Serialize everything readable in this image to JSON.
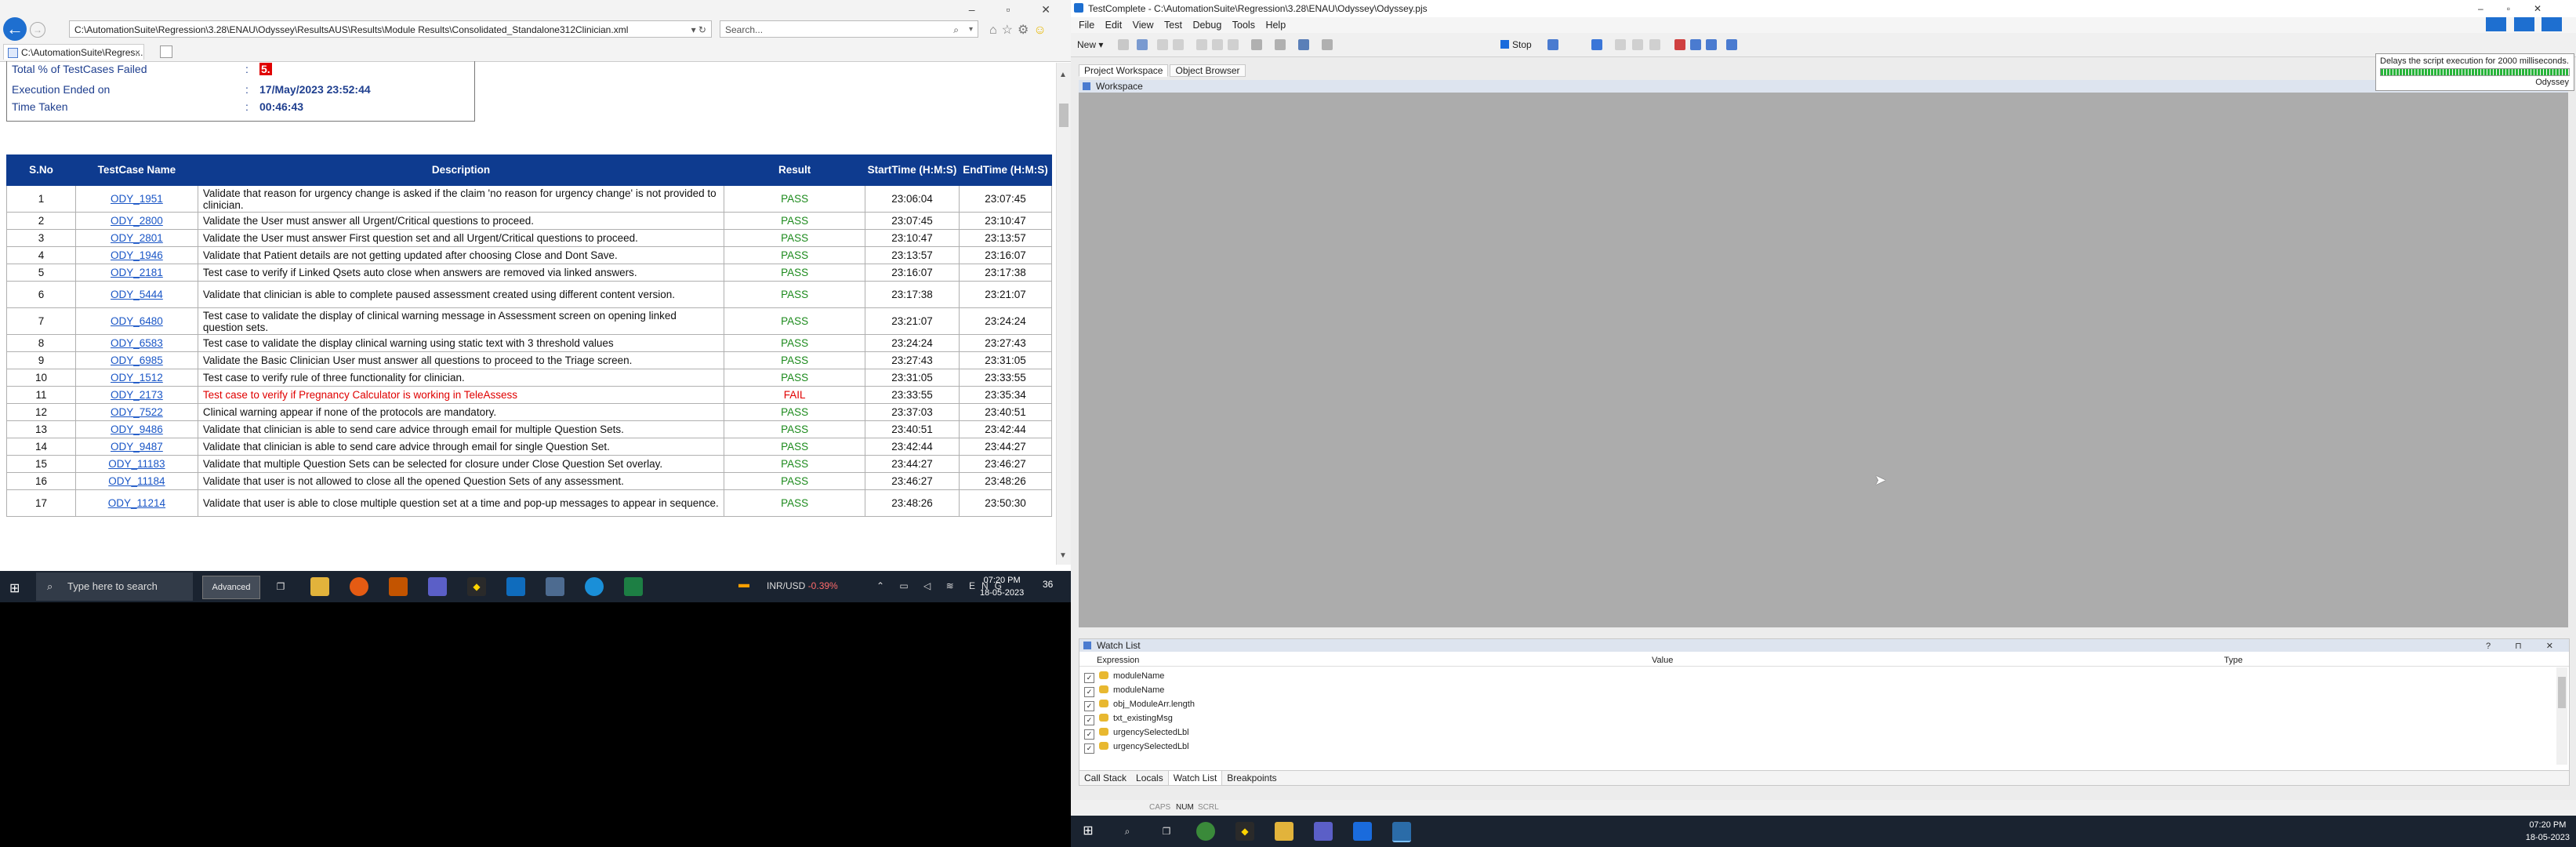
{
  "browser": {
    "address": "C:\\AutomationSuite\\Regression\\3.28\\ENAU\\Odyssey\\ResultsAUS\\Results\\Module Results\\Consolidated_Standalone312Clinician.xml",
    "address_controls": "▾ ↻",
    "search_placeholder": "Search...",
    "tab_title": "C:\\AutomationSuite\\Regres...",
    "back_glyph": "←",
    "forward_glyph": "→",
    "close_glyph": "×",
    "window_controls": "–  ▫  ✕",
    "toolbar_icons": [
      "home-icon",
      "star-icon",
      "gear-icon",
      "smiley-icon"
    ]
  },
  "summary": {
    "rows": [
      {
        "label": "Total % of TestCases Failed",
        "colon": ":",
        "value": "5."
      },
      {
        "label": "Execution Ended on",
        "colon": ":",
        "value": "17/May/2023 23:52:44"
      },
      {
        "label": "Time Taken",
        "colon": ":",
        "value": "00:46:43"
      }
    ]
  },
  "results_table": {
    "headers": [
      "S.No",
      "TestCase Name",
      "Description",
      "Result",
      "StartTime (H:M:S)",
      "EndTime (H:M:S)"
    ],
    "rows": [
      {
        "sno": "1",
        "name": "ODY_1951",
        "desc": "Validate that reason for urgency change is asked if the claim 'no reason for urgency change' is not provided to clinician.",
        "result": "PASS",
        "start": "23:06:04",
        "end": "23:07:45"
      },
      {
        "sno": "2",
        "name": "ODY_2800",
        "desc": "Validate the User must answer all Urgent/Critical questions to proceed.",
        "result": "PASS",
        "start": "23:07:45",
        "end": "23:10:47"
      },
      {
        "sno": "3",
        "name": "ODY_2801",
        "desc": "Validate the User must answer First question set and all Urgent/Critical questions to proceed.",
        "result": "PASS",
        "start": "23:10:47",
        "end": "23:13:57"
      },
      {
        "sno": "4",
        "name": "ODY_1946",
        "desc": "Validate that Patient details are not getting updated after choosing Close and Dont Save.",
        "result": "PASS",
        "start": "23:13:57",
        "end": "23:16:07"
      },
      {
        "sno": "5",
        "name": "ODY_2181",
        "desc": "Test case to verify if Linked Qsets auto close when answers are removed via linked answers.",
        "result": "PASS",
        "start": "23:16:07",
        "end": "23:17:38"
      },
      {
        "sno": "6",
        "name": "ODY_5444",
        "desc": "Validate that clinician is able to complete paused assessment created using different content version.",
        "result": "PASS",
        "start": "23:17:38",
        "end": "23:21:07"
      },
      {
        "sno": "7",
        "name": "ODY_6480",
        "desc": "Test case to validate the display of clinical warning message in Assessment screen on opening linked question sets.",
        "result": "PASS",
        "start": "23:21:07",
        "end": "23:24:24"
      },
      {
        "sno": "8",
        "name": "ODY_6583",
        "desc": "Test case to validate the display clinical warning using static text with 3 threshold values",
        "result": "PASS",
        "start": "23:24:24",
        "end": "23:27:43"
      },
      {
        "sno": "9",
        "name": "ODY_6985",
        "desc": "Validate the Basic Clinician User must answer all questions to proceed to the Triage screen.",
        "result": "PASS",
        "start": "23:27:43",
        "end": "23:31:05"
      },
      {
        "sno": "10",
        "name": "ODY_1512",
        "desc": "Test case to verify rule of three functionality for clinician.",
        "result": "PASS",
        "start": "23:31:05",
        "end": "23:33:55"
      },
      {
        "sno": "11",
        "name": "ODY_2173",
        "desc": "Test case to verify if Pregnancy Calculator is working in TeleAssess",
        "result": "FAIL",
        "start": "23:33:55",
        "end": "23:35:34"
      },
      {
        "sno": "12",
        "name": "ODY_7522",
        "desc": "Clinical warning appear if none of the protocols are mandatory.",
        "result": "PASS",
        "start": "23:37:03",
        "end": "23:40:51"
      },
      {
        "sno": "13",
        "name": "ODY_9486",
        "desc": "Validate that clinician is able to send care advice through email for multiple Question Sets.",
        "result": "PASS",
        "start": "23:40:51",
        "end": "23:42:44"
      },
      {
        "sno": "14",
        "name": "ODY_9487",
        "desc": "Validate that clinician is able to send care advice through email for single Question Set.",
        "result": "PASS",
        "start": "23:42:44",
        "end": "23:44:27"
      },
      {
        "sno": "15",
        "name": "ODY_11183",
        "desc": "Validate that multiple Question Sets can be selected for closure under Close Question Set overlay.",
        "result": "PASS",
        "start": "23:44:27",
        "end": "23:46:27"
      },
      {
        "sno": "16",
        "name": "ODY_11184",
        "desc": "Validate that user is not allowed to close all the opened Question Sets of any assessment.",
        "result": "PASS",
        "start": "23:46:27",
        "end": "23:48:26"
      },
      {
        "sno": "17",
        "name": "ODY_11214",
        "desc": "Validate that user is able to close multiple question set at a time and pop-up messages to appear in sequence.",
        "result": "PASS",
        "start": "23:48:26",
        "end": "23:50:30"
      }
    ]
  },
  "taskbar_left": {
    "search_placeholder": "Type here to search",
    "advanced_label": "Advanced",
    "currency": "INR/USD",
    "currency_change": "-0.39%",
    "lang": "ENG",
    "time": "07:20 PM",
    "date": "18-05-2023",
    "notif_count": "36"
  },
  "testcomplete": {
    "title": "TestComplete - C:\\AutomationSuite\\Regression\\3.28\\ENAU\\Odyssey\\Odyssey.pjs",
    "menu": [
      "File",
      "Edit",
      "View",
      "Test",
      "Debug",
      "Tools",
      "Help"
    ],
    "new_label": "New",
    "stop_label": "Stop",
    "tabs": [
      "Project Workspace",
      "Object Browser"
    ],
    "workspace_label": "Workspace",
    "tooltip_text": "Delays the script execution for 2000 milliseconds.",
    "tooltip_project": "Odyssey",
    "watch_title": "Watch List",
    "watch_columns": [
      "Expression",
      "Value",
      "Type"
    ],
    "watch_rows": [
      "moduleName",
      "moduleName",
      "obj_ModuleArr.length",
      "txt_existingMsg",
      "urgencySelectedLbl",
      "urgencySelectedLbl"
    ],
    "bottom_tabs": [
      "Call Stack",
      "Locals",
      "Watch List",
      "Breakpoints"
    ],
    "status": [
      "CAPS",
      "NUM",
      "SCRL"
    ]
  },
  "taskbar_right": {
    "time": "07:20 PM",
    "date": "18-05-2023"
  },
  "colors": {
    "header_blue": "#0e3b8f",
    "pass": "#1c8a1c",
    "fail": "#e00000",
    "link": "#1a56c6"
  }
}
